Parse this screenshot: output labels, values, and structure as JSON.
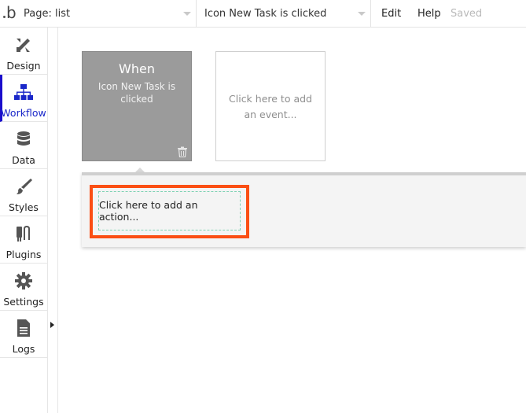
{
  "topbar": {
    "logo": "b",
    "page_selector": "Page: list",
    "event_selector": "Icon New Task is clicked",
    "edit_label": "Edit",
    "help_label": "Help",
    "status": "Saved"
  },
  "sidebar": {
    "items": [
      {
        "label": "Design",
        "icon": "design-icon"
      },
      {
        "label": "Workflow",
        "icon": "workflow-icon",
        "active": true
      },
      {
        "label": "Data",
        "icon": "database-icon"
      },
      {
        "label": "Styles",
        "icon": "brush-icon"
      },
      {
        "label": "Plugins",
        "icon": "plug-icon"
      },
      {
        "label": "Settings",
        "icon": "gear-icon"
      },
      {
        "label": "Logs",
        "icon": "document-icon"
      }
    ]
  },
  "workflow": {
    "event_card": {
      "title": "When",
      "description": "Icon New Task is clicked",
      "delete_icon": "trash-icon"
    },
    "add_event_label": "Click here to add an event...",
    "add_action_label": "Click here to add an action..."
  },
  "colors": {
    "active_accent": "#1a27c9",
    "event_card_bg": "#9b9b9b",
    "highlight": "#fb4f14",
    "dashed_border": "#7fd3b4"
  }
}
